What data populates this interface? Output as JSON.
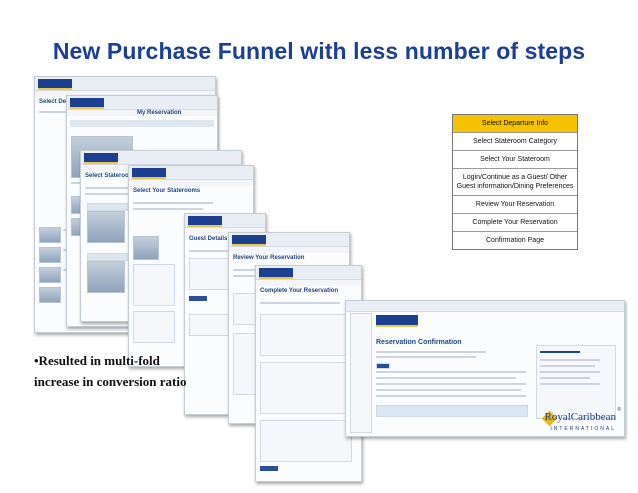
{
  "slide_title": "New Purchase Funnel with less number of steps",
  "steps": [
    {
      "label": "Select Departure Info",
      "highlight": "#f5c100"
    },
    {
      "label": "Select Stateroom Category"
    },
    {
      "label": "Select Your Stateroom"
    },
    {
      "label": "Login/Continue as a Guest/ Other Guest information/Dining Preferences"
    },
    {
      "label": "Review Your Reservation"
    },
    {
      "label": "Complete Your Reservation"
    },
    {
      "label": "Confirmation Page"
    }
  ],
  "notes": {
    "line1": "•Resulted in multi-fold",
    "line2": "increase in conversion ratio"
  },
  "screens": [
    {
      "heading": "Select Departure Information"
    },
    {
      "heading": "My Reservation"
    },
    {
      "heading": "Select Staterooms Category"
    },
    {
      "heading": "Select Your Staterooms"
    },
    {
      "heading": "Guest Details"
    },
    {
      "heading": "Review Your Reservation"
    },
    {
      "heading": "Complete Your Reservation"
    },
    {
      "heading": "Reservation Confirmation"
    }
  ],
  "brand": {
    "name": "RoyalCaribbean",
    "sub": "INTERNATIONAL",
    "mark": "®",
    "color": "#173d8a"
  },
  "colors": {
    "title": "#1b3f93",
    "accent": "#f5c100"
  }
}
